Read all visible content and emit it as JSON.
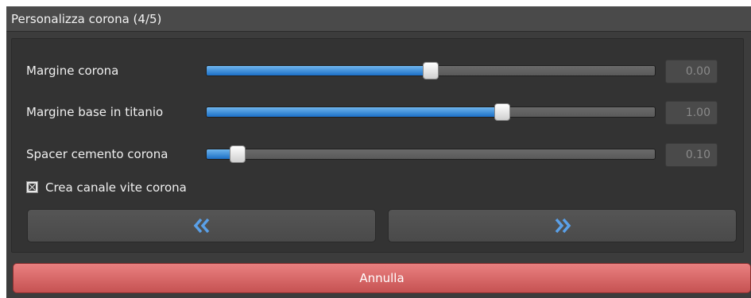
{
  "window": {
    "title": "Personalizza corona (4/5)"
  },
  "sliders": [
    {
      "label": "Margine corona",
      "value": "0.00",
      "position": 0.5
    },
    {
      "label": "Margine base in titanio",
      "value": "1.00",
      "position": 0.66
    },
    {
      "label": "Spacer cemento corona",
      "value": "0.10",
      "position": 0.07
    }
  ],
  "checkbox": {
    "label": "Crea canale vite corona",
    "checked": true
  },
  "nav": {
    "back_icon": "double-chevron-left-icon",
    "forward_icon": "double-chevron-right-icon"
  },
  "cancel": {
    "label": "Annulla"
  },
  "colors": {
    "accent": "#1c6fc6",
    "cancel": "#d96565",
    "background": "#3c3c3c"
  }
}
